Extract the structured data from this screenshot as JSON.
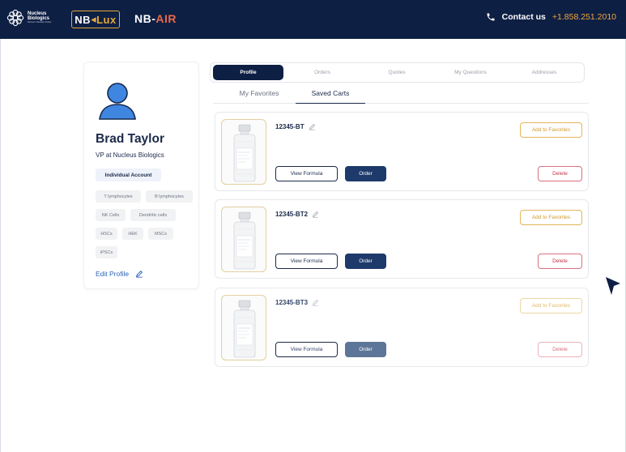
{
  "header": {
    "brand_line1": "Nucleus",
    "brand_line2": "Biologics",
    "brand_tagline": "Discover. Develop. Deliver.",
    "lux_logo": {
      "a": "NB",
      "b": "Lux"
    },
    "air_logo": {
      "a": "NB-",
      "b": "AIR"
    },
    "contact_label": "Contact us",
    "contact_phone": "+1.858.251.2010",
    "icon": "phone-icon"
  },
  "colors": {
    "navy": "#0e1f44",
    "orange": "#f2a63b",
    "order_blue": "#1d3a6b",
    "delete_red": "#c2364b",
    "favorite_gold": "#d29a2a",
    "link_blue": "#2a62b8"
  },
  "profile": {
    "name": "Brad Taylor",
    "title": "VP at Nucleus Biologics",
    "account_type": "Individual Account",
    "tags": [
      "T lymphocytes",
      "B lymphocytes",
      "NK Cells",
      "Dendritic cells",
      "HSCs",
      "HEK",
      "MSCs",
      "iPSCs"
    ],
    "edit_label": "Edit Profile"
  },
  "tabs": [
    {
      "label": "Profile",
      "active": true
    },
    {
      "label": "Orders",
      "active": false
    },
    {
      "label": "Quotes",
      "active": false
    },
    {
      "label": "My Questions",
      "active": false
    },
    {
      "label": "Addresses",
      "active": false
    }
  ],
  "subtabs": [
    {
      "label": "My Favorites",
      "active": false
    },
    {
      "label": "Saved Carts",
      "active": true
    }
  ],
  "carts": [
    {
      "sku": "12345-BT",
      "view_label": "View Formula",
      "order_label": "Order",
      "favorite_label": "Add to Favorites",
      "delete_label": "Delete"
    },
    {
      "sku": "12345-BT2",
      "view_label": "View Formula",
      "order_label": "Order",
      "favorite_label": "Add to Favorites",
      "delete_label": "Delete"
    },
    {
      "sku": "12345-BT3",
      "view_label": "View Formula",
      "order_label": "Order",
      "favorite_label": "Add to Favorites",
      "delete_label": "Delete"
    }
  ]
}
